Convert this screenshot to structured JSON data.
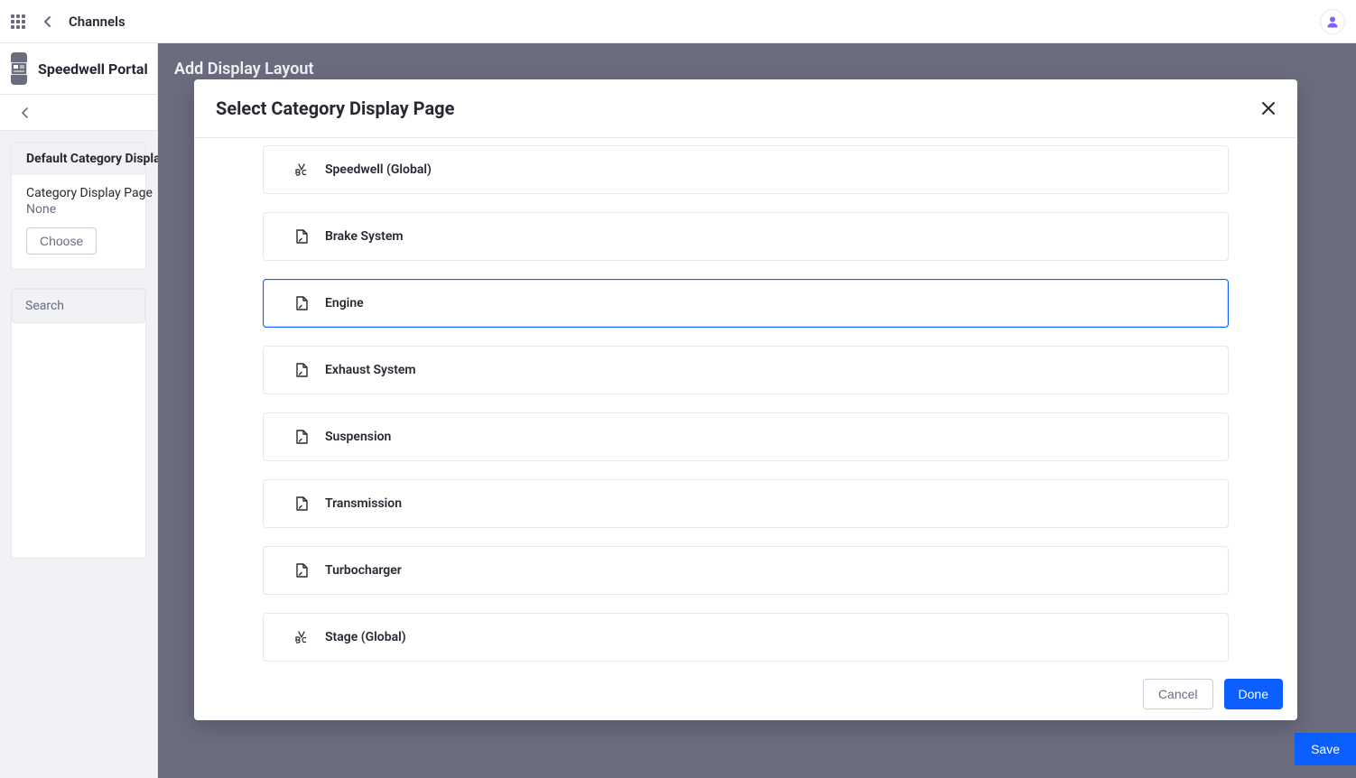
{
  "topbar": {
    "title": "Channels"
  },
  "sidebar": {
    "portal_name": "Speedwell Portal",
    "config_card_title": "Default Category Display Page",
    "config_label": "Category Display Page",
    "config_value": "None",
    "choose_label": "Choose",
    "search_placeholder": "Search"
  },
  "slideover": {
    "title": "Add Display Layout",
    "save_label": "Save"
  },
  "modal": {
    "title": "Select Category Display Page",
    "selected_index": 2,
    "options": [
      {
        "label": "Speedwell (Global)",
        "icon": "abc"
      },
      {
        "label": "Brake System",
        "icon": "page"
      },
      {
        "label": "Engine",
        "icon": "page"
      },
      {
        "label": "Exhaust System",
        "icon": "page"
      },
      {
        "label": "Suspension",
        "icon": "page"
      },
      {
        "label": "Transmission",
        "icon": "page"
      },
      {
        "label": "Turbocharger",
        "icon": "page"
      },
      {
        "label": "Stage (Global)",
        "icon": "abc"
      }
    ],
    "cancel_label": "Cancel",
    "done_label": "Done"
  }
}
